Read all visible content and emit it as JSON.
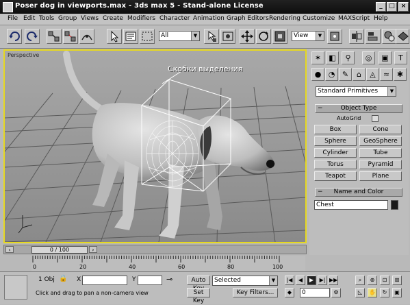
{
  "window": {
    "title": "Poser dog in viewports.max - 3ds max 5 - Stand-alone License",
    "minimize": "_",
    "maximize": "□",
    "close": "×"
  },
  "menu": [
    "File",
    "Edit",
    "Tools",
    "Group",
    "Views",
    "Create",
    "Modifiers",
    "Character",
    "Animation",
    "Graph Editors",
    "Rendering",
    "Customize",
    "MAXScript",
    "Help"
  ],
  "toolbar": {
    "selection_filter": "All",
    "reference_coord": "View",
    "icons": [
      "undo-icon",
      "redo-icon",
      "select-link-icon",
      "unlink-icon",
      "bind-space-warp-icon",
      "select-icon",
      "select-region-icon",
      "move-icon",
      "rotate-icon",
      "scale-icon",
      "mirror-icon",
      "align-icon",
      "material-editor-icon",
      "render-icon"
    ]
  },
  "viewport": {
    "label": "Perspective",
    "annotation": "Скобки выделения",
    "border_color": "#e6d820"
  },
  "command_panel": {
    "tabs": [
      "create-tab",
      "modify-tab",
      "hierarchy-tab",
      "motion-tab",
      "display-tab",
      "utilities-tab"
    ],
    "category": "Standard Primitives",
    "object_type_header": "Object Type",
    "autogrid_label": "AutoGrid",
    "object_buttons": [
      "Box",
      "Cone",
      "Sphere",
      "GeoSphere",
      "Cylinder",
      "Tube",
      "Torus",
      "Pyramid",
      "Teapot",
      "Plane"
    ],
    "name_color_header": "Name and Color",
    "object_name": "Chest",
    "object_color": "#1a1a1a"
  },
  "timeline": {
    "time_slider": "0 / 100",
    "ruler_labels": [
      "0",
      "20",
      "40",
      "60",
      "80",
      "100"
    ]
  },
  "status": {
    "selected_count": "1 Obj",
    "x_label": "X",
    "y_label": "Y",
    "auto_key": "Auto Key",
    "set_key": "Set Key",
    "key_mode": "Selected",
    "key_filters": "Key Filters...",
    "frame": "0",
    "prompt": "Click and drag to pan a non-camera view"
  }
}
